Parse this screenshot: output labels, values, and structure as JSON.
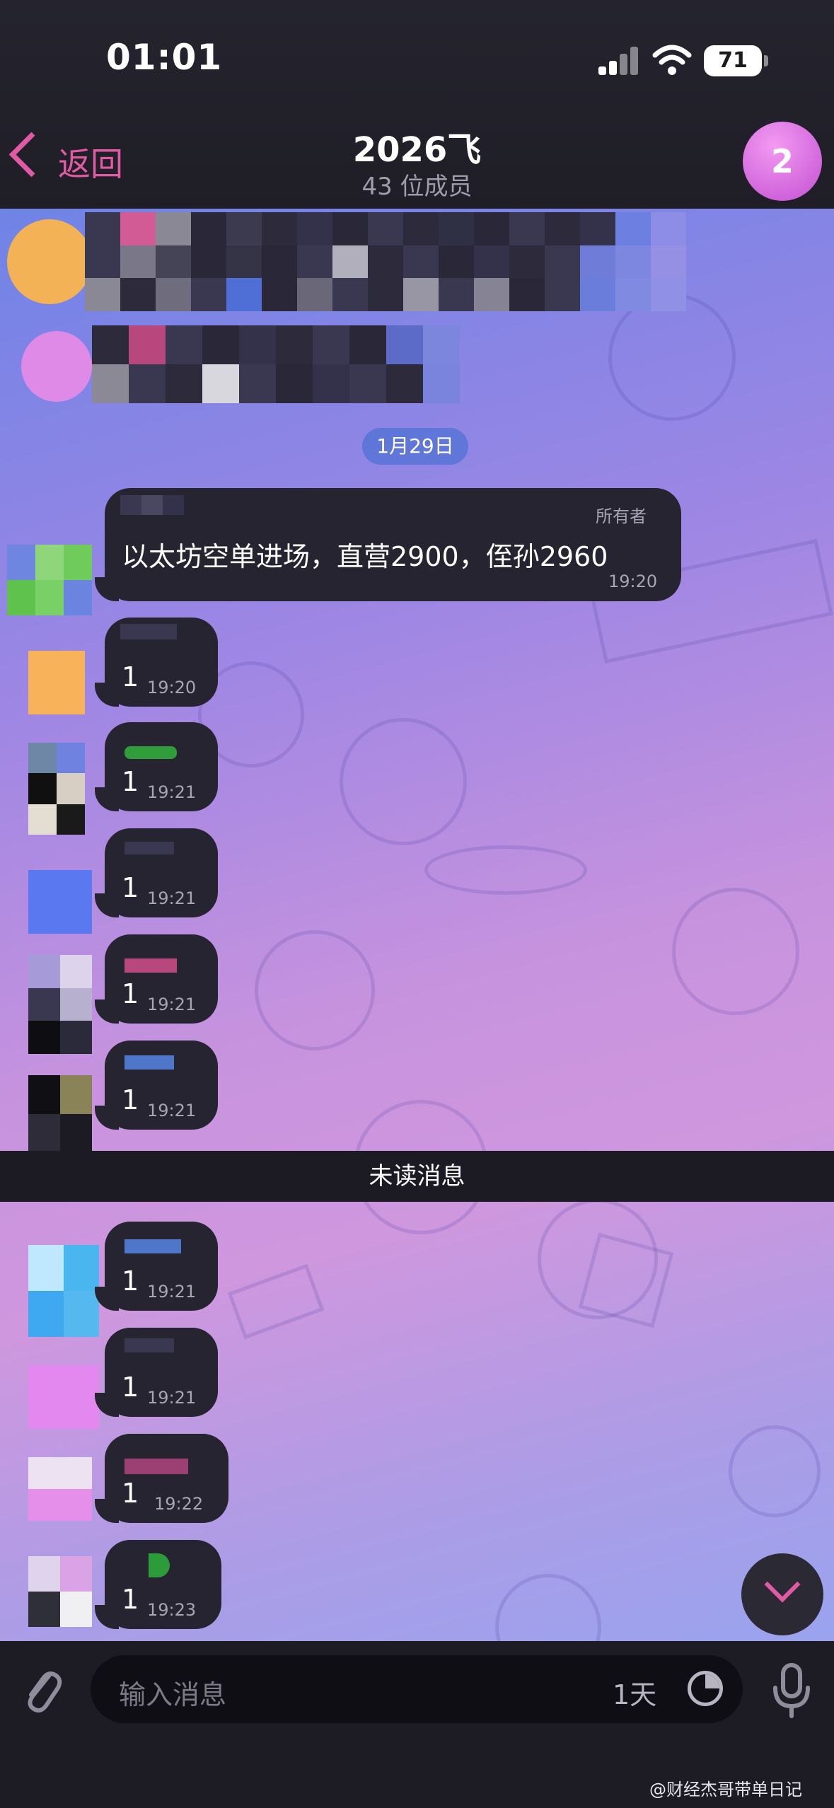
{
  "status_bar": {
    "time": "01:01",
    "battery": "71"
  },
  "header": {
    "back_label": "返回",
    "title": "2026飞",
    "subtitle": "43 位成员",
    "unread_badge": "2"
  },
  "chat": {
    "date_pill": "1月29日",
    "pinned_message": {
      "role": "所有者",
      "text": "以太坊空单进场，直营2900，侄孙2960",
      "time": "19:20"
    },
    "replies_before_divider": [
      {
        "text": "1",
        "time": "19:20"
      },
      {
        "text": "1",
        "time": "19:21"
      },
      {
        "text": "1",
        "time": "19:21"
      },
      {
        "text": "1",
        "time": "19:21"
      },
      {
        "text": "1",
        "time": "19:21"
      }
    ],
    "unread_divider": "未读消息",
    "replies_after_divider": [
      {
        "text": "1",
        "time": "19:21"
      },
      {
        "text": "1",
        "time": "19:21"
      },
      {
        "text": "1",
        "time": "19:22"
      },
      {
        "text": "1",
        "time": "19:23"
      }
    ]
  },
  "input_bar": {
    "placeholder": "输入消息",
    "timer_label": "1天"
  },
  "watermark": "@财经杰哥带单日记",
  "icons": [
    "back-chevron-icon",
    "signal-icon",
    "wifi-icon",
    "battery-icon",
    "attach-icon",
    "timer-icon",
    "mic-icon",
    "scroll-down-icon"
  ],
  "colors": {
    "accent": "#e05aa4",
    "bubble": "#262431",
    "header_bg": "#25242e"
  }
}
